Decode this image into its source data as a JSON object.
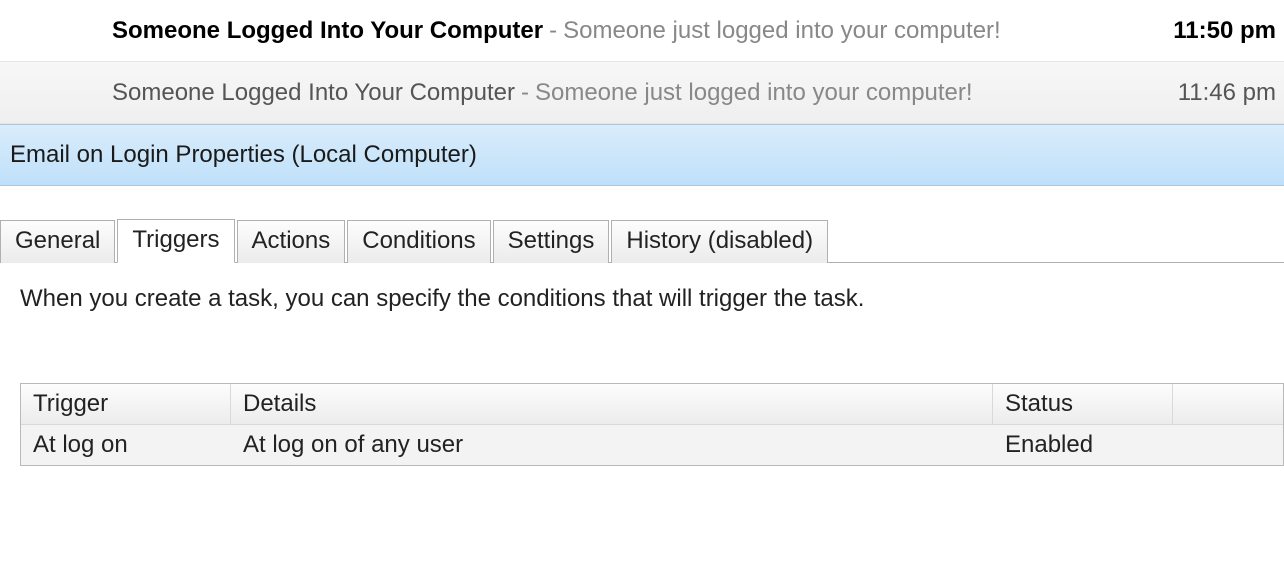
{
  "emails": [
    {
      "subject": "Someone Logged Into Your Computer",
      "preview": "Someone just logged into your computer!",
      "time": "11:50 pm",
      "unread": true
    },
    {
      "subject": "Someone Logged Into Your Computer",
      "preview": "Someone just logged into your computer!",
      "time": "11:46 pm",
      "unread": false
    }
  ],
  "dialog": {
    "title": "Email on Login Properties (Local Computer)"
  },
  "tabs": {
    "general": "General",
    "triggers": "Triggers",
    "actions": "Actions",
    "conditions": "Conditions",
    "settings": "Settings",
    "history": "History (disabled)",
    "active": "triggers"
  },
  "triggers_panel": {
    "description": "When you create a task, you can specify the conditions that will trigger the task.",
    "columns": {
      "trigger": "Trigger",
      "details": "Details",
      "status": "Status"
    },
    "rows": [
      {
        "trigger": "At log on",
        "details": "At log on of any user",
        "status": "Enabled"
      }
    ]
  }
}
